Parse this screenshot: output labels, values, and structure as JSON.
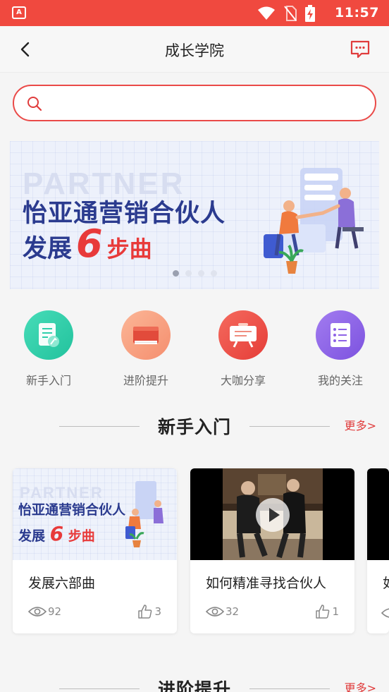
{
  "status_bar": {
    "time": "11:57",
    "app_icon_text": "A"
  },
  "header": {
    "title": "成长学院",
    "back_icon": "chevron-left-icon",
    "message_icon": "chat-bubble-icon"
  },
  "search": {
    "value": "",
    "placeholder": ""
  },
  "banner": {
    "background_word": "PARTNER",
    "line1": "怡亚通营销合伙人",
    "line2_prefix": "发展",
    "line2_number": "6",
    "line2_suffix": "步曲",
    "page_count": 4,
    "active_page": 1
  },
  "categories": [
    {
      "label": "新手入门",
      "icon": "document-icon",
      "color": "#2fcfab"
    },
    {
      "label": "进阶提升",
      "icon": "book-icon",
      "color": "#f27a5a"
    },
    {
      "label": "大咖分享",
      "icon": "presentation-board-icon",
      "color": "#ee4a44"
    },
    {
      "label": "我的关注",
      "icon": "list-icon",
      "color": "#8e63e6"
    }
  ],
  "sections": [
    {
      "title": "新手入门",
      "more_label": "更多>",
      "cards": [
        {
          "title": "发展六部曲",
          "views": "92",
          "likes": "3"
        },
        {
          "title": "如何精准寻找合伙人",
          "views": "32",
          "likes": "1"
        },
        {
          "title": "如"
        }
      ]
    },
    {
      "title": "进阶提升",
      "more_label": "更多>"
    }
  ],
  "colors": {
    "accent": "#f0493f",
    "more_link": "#e03c3c",
    "banner_text": "#2b3b8f"
  }
}
